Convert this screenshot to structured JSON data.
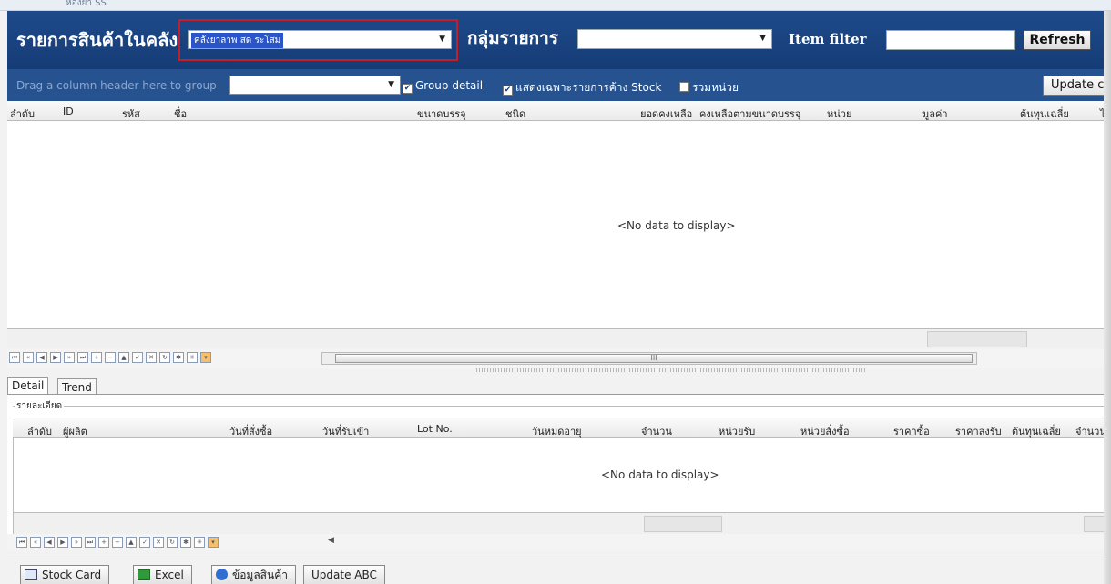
{
  "header": {
    "top_text": "ห้องยา SS",
    "title": "รายการสินค้าในคลัง",
    "warehouse_selected": "คลังยาลาพ สด ระโสม",
    "group_label": "กลุ่มรายการ",
    "group_selected": "",
    "filter_label": "Item filter",
    "filter_value": "",
    "refresh_label": "Refresh"
  },
  "groupbar": {
    "drag_hint": "Drag a column header here to group",
    "group_field_value": "",
    "group_detail_label": "Group detail",
    "group_detail_checked": true,
    "stock_only_label": "แสดงเฉพาะรายการค้าง Stock",
    "stock_only_checked": true,
    "combine_unit_label": "รวมหน่วย",
    "combine_unit_checked": false,
    "update_label": "Update c"
  },
  "grid1": {
    "columns": [
      "ลำดับ",
      "ID",
      "รหัส",
      "ชื่อ",
      "ขนาดบรรจุ",
      "ชนิด",
      "ยอดคงเหลือ",
      "คงเหลือตามขนาดบรรจุ",
      "หน่วย",
      "มูลค่า",
      "ต้นทุนเฉลี่ย",
      "ไ"
    ],
    "no_data": "<No data to display>",
    "scroll_marker": "III"
  },
  "tabs": [
    "Detail",
    "Trend"
  ],
  "detail": {
    "legend": "รายละเอียด",
    "columns": [
      "ลำดับ",
      "ผู้ผลิต",
      "วันที่สั่งซื้อ",
      "วันที่รับเข้า",
      "Lot No.",
      "วันหมดอายุ",
      "จำนวน",
      "หน่วยรับ",
      "หน่วยสั่งซื้อ",
      "ราคาซื้อ",
      "ราคาลงรับ",
      "ต้นทุนเฉลี่ย",
      "จำนวน"
    ],
    "no_data": "<No data to display>"
  },
  "bottom_buttons": [
    "Stock Card",
    "Excel",
    "ข้อมูลสินค้า",
    "Update ABC"
  ],
  "colors": {
    "header_bg": "#1e4a8a",
    "groupbar_bg": "#26538f",
    "highlight_border": "#c0202a"
  }
}
